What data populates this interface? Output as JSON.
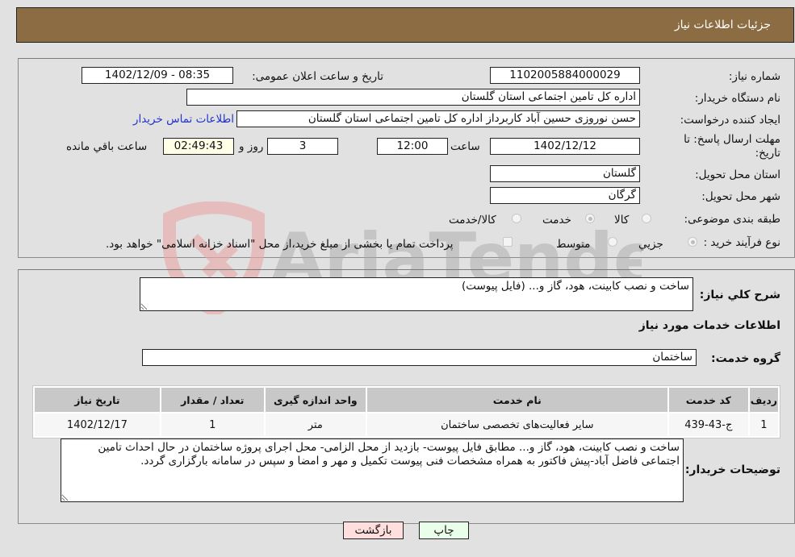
{
  "header": {
    "title": "جزئیات اطلاعات نیاز"
  },
  "form": {
    "need_number": {
      "label": "شماره نیاز:",
      "value": "1102005884000029"
    },
    "announce_datetime": {
      "label": "تاریخ و ساعت اعلان عمومی:",
      "value": "1402/12/09 - 08:35"
    },
    "buyer_org": {
      "label": "نام دستگاه خریدار:",
      "value": "اداره کل تامین اجتماعی استان گلستان"
    },
    "requester": {
      "label": "ایجاد کننده درخواست:",
      "value": "حسن نوروزی حسین آباد کاربرداز اداره کل تامین اجتماعی استان گلستان"
    },
    "buyer_contact_link": "اطلاعات تماس خریدار",
    "deadline": {
      "label": "مهلت ارسال پاسخ: تا تاریخ:",
      "date": "1402/12/12",
      "time_label": "ساعت",
      "time": "12:00",
      "days": "3",
      "days_label": "روز و",
      "remaining": "02:49:43",
      "remaining_label": "ساعت باقي مانده"
    },
    "province": {
      "label": "استان محل تحویل:",
      "value": "گلستان"
    },
    "city": {
      "label": "شهر محل تحویل:",
      "value": "گرگان"
    },
    "category": {
      "label": "طبقه بندی موضوعی:",
      "options": [
        "کالا",
        "خدمت",
        "کالا/خدمت"
      ],
      "selected": "خدمت"
    },
    "purchase_type": {
      "label": "نوع فرآیند خرید :",
      "options": [
        "جزيي",
        "متوسط"
      ],
      "selected": "جزيي",
      "treasury_note": "پرداخت تمام یا بخشی از مبلغ خرید،از محل \"اسناد خزانه اسلامی\" خواهد بود."
    }
  },
  "details": {
    "summary": {
      "label": "شرح کلي نياز:",
      "value": "ساخت و نصب کابینت، هود، گاز و... (فایل پیوست)"
    },
    "services_title": "اطلاعات خدمات مورد نیاز",
    "service_group": {
      "label": "گروه خدمت:",
      "value": "ساختمان"
    },
    "table": {
      "headers": [
        "رديف",
        "کد خدمت",
        "نام خدمت",
        "واحد اندازه گیری",
        "تعداد / مقدار",
        "تاریخ نیاز"
      ],
      "rows": [
        [
          "1",
          "ج-43-439",
          "سایر فعالیت‌های تخصصی ساختمان",
          "متر",
          "1",
          "1402/12/17"
        ]
      ]
    },
    "buyer_notes": {
      "label": "توضیحات خریدار:",
      "value": "ساخت و نصب کابینت، هود، گاز و... مطابق فایل پیوست- بازدید از محل الزامی- محل اجرای پروژه ساختمان در حال احداث تامین اجتماعی فاضل آباد-پیش فاکتور به همراه مشخصات فنی پیوست تکمیل و مهر و امضا و سپس در سامانه بارگزاری گردد."
    }
  },
  "buttons": {
    "print": "چاپ",
    "back": "بازگشت"
  },
  "watermark": {
    "text": "AriaTender.neT",
    "colors": {
      "logo": "#e8a0a0",
      "text": "#9a9a9a"
    }
  }
}
